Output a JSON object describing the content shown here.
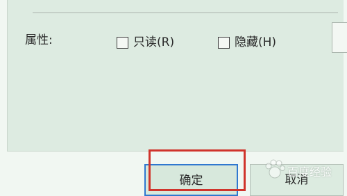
{
  "attributes": {
    "label": "属性:",
    "readonly": {
      "label": "只读(R)",
      "checked": false
    },
    "hidden": {
      "label": "隐藏(H)",
      "checked": false
    }
  },
  "buttons": {
    "ok": "确定",
    "cancel": "取消"
  },
  "watermark": {
    "text": "百度经验"
  },
  "colors": {
    "highlight": "#d0342c",
    "focus_border": "#2f78d0"
  }
}
